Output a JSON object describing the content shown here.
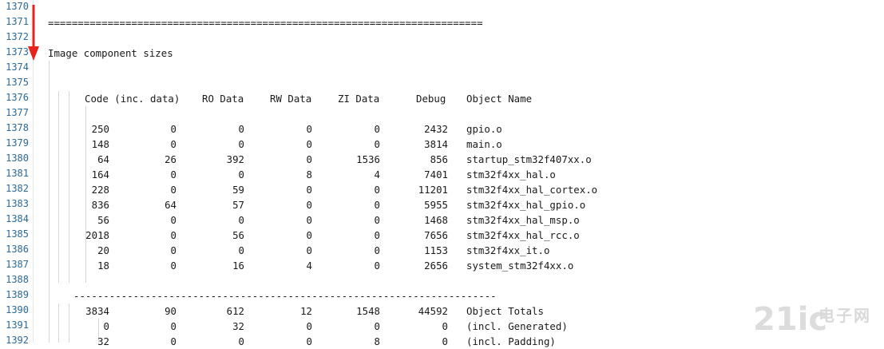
{
  "line_numbers": [
    "1370",
    "1371",
    "1372",
    "1373",
    "1374",
    "1375",
    "1376",
    "1377",
    "1378",
    "1379",
    "1380",
    "1381",
    "1382",
    "1383",
    "1384",
    "1385",
    "1386",
    "1387",
    "1388",
    "1389",
    "1390",
    "1391",
    "1392"
  ],
  "separator_equals": "=========================================================================",
  "section_title": "Image component sizes",
  "columns": {
    "code": "Code (inc. data)",
    "ro": "RO Data",
    "rw": "RW Data",
    "zi": "ZI Data",
    "debug": "Debug",
    "object": "Object Name"
  },
  "rows": [
    {
      "code": "250",
      "inc": "0",
      "ro": "0",
      "rw": "0",
      "zi": "0",
      "debug": "2432",
      "name": "gpio.o"
    },
    {
      "code": "148",
      "inc": "0",
      "ro": "0",
      "rw": "0",
      "zi": "0",
      "debug": "3814",
      "name": "main.o"
    },
    {
      "code": "64",
      "inc": "26",
      "ro": "392",
      "rw": "0",
      "zi": "1536",
      "debug": "856",
      "name": "startup_stm32f407xx.o"
    },
    {
      "code": "164",
      "inc": "0",
      "ro": "0",
      "rw": "8",
      "zi": "4",
      "debug": "7401",
      "name": "stm32f4xx_hal.o"
    },
    {
      "code": "228",
      "inc": "0",
      "ro": "59",
      "rw": "0",
      "zi": "0",
      "debug": "11201",
      "name": "stm32f4xx_hal_cortex.o"
    },
    {
      "code": "836",
      "inc": "64",
      "ro": "57",
      "rw": "0",
      "zi": "0",
      "debug": "5955",
      "name": "stm32f4xx_hal_gpio.o"
    },
    {
      "code": "56",
      "inc": "0",
      "ro": "0",
      "rw": "0",
      "zi": "0",
      "debug": "1468",
      "name": "stm32f4xx_hal_msp.o"
    },
    {
      "code": "2018",
      "inc": "0",
      "ro": "56",
      "rw": "0",
      "zi": "0",
      "debug": "7656",
      "name": "stm32f4xx_hal_rcc.o"
    },
    {
      "code": "20",
      "inc": "0",
      "ro": "0",
      "rw": "0",
      "zi": "0",
      "debug": "1153",
      "name": "stm32f4xx_it.o"
    },
    {
      "code": "18",
      "inc": "0",
      "ro": "16",
      "rw": "4",
      "zi": "0",
      "debug": "2656",
      "name": "system_stm32f4xx.o"
    }
  ],
  "separator_dashes": "-----------------------------------------------------------------------",
  "totals": [
    {
      "code": "3834",
      "inc": "90",
      "ro": "612",
      "rw": "12",
      "zi": "1548",
      "debug": "44592",
      "name": "Object Totals"
    },
    {
      "code": "0",
      "inc": "0",
      "ro": "32",
      "rw": "0",
      "zi": "0",
      "debug": "0",
      "name": "(incl. Generated)"
    },
    {
      "code": "32",
      "inc": "0",
      "ro": "0",
      "rw": "0",
      "zi": "8",
      "debug": "0",
      "name": "(incl. Padding)"
    }
  ],
  "colors": {
    "line_number": "#2b6a99",
    "text": "#1a1a1a",
    "arrow": "#e8231f",
    "guide": "#d6d6d6"
  },
  "icons": {
    "arrow": "red-down-arrow-icon",
    "watermark": "21ic-watermark-logo"
  },
  "watermark": {
    "brand": "21ic",
    "subtitle": "电子网"
  }
}
